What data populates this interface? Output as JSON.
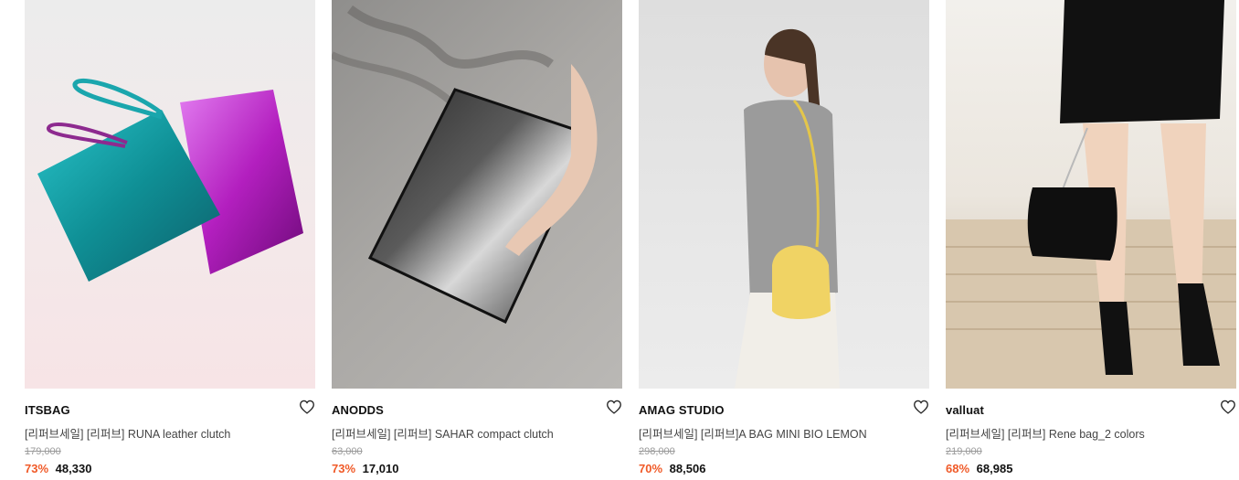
{
  "products": [
    {
      "brand": "ITSBAG",
      "title": "[리퍼브세일] [리퍼브] RUNA leather clutch",
      "original_price": "179,000",
      "discount": "73%",
      "price": "48,330",
      "image": "metallic-clutch-photo"
    },
    {
      "brand": "ANODDS",
      "title": "[리퍼브세일] [리퍼브] SAHAR compact clutch",
      "original_price": "63,000",
      "discount": "73%",
      "price": "17,010",
      "image": "marble-clutch-photo"
    },
    {
      "brand": "AMAG STUDIO",
      "title": "[리퍼브세일] [리퍼브]A BAG MINI BIO LEMON",
      "original_price": "298,000",
      "discount": "70%",
      "price": "88,506",
      "image": "model-yellow-bag-photo"
    },
    {
      "brand": "valluat",
      "title": "[리퍼브세일] [리퍼브] Rene bag_2 colors",
      "original_price": "219,000",
      "discount": "68%",
      "price": "68,985",
      "image": "black-chain-bag-photo"
    }
  ],
  "icons": {
    "wishlist": "heart-outline-icon"
  },
  "colors": {
    "discount": "#f05a28",
    "strikethrough": "#9a9a9a"
  }
}
